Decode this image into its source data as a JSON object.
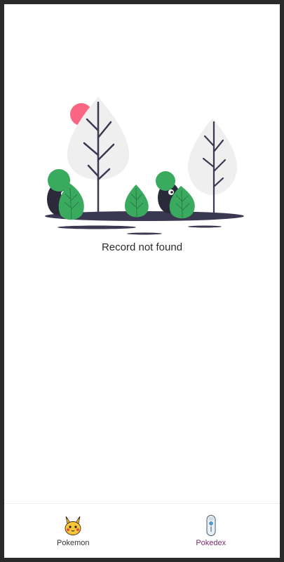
{
  "empty_state": {
    "message": "Record not found",
    "illustration_icon": "forest-illustration"
  },
  "bottom_nav": {
    "items": [
      {
        "label": "Pokemon",
        "icon": "pikachu-icon",
        "active": false
      },
      {
        "label": "Pokedex",
        "icon": "pokedex-device-icon",
        "active": true
      }
    ]
  },
  "colors": {
    "background": "#ffffff",
    "frame": "#2a2a2a",
    "leaf_green": "#3aaa5f",
    "tree_gray": "#efeff0",
    "trunk_dark": "#3b3852",
    "sun_pink": "#fb6584",
    "active_label": "#7b2d6b"
  }
}
